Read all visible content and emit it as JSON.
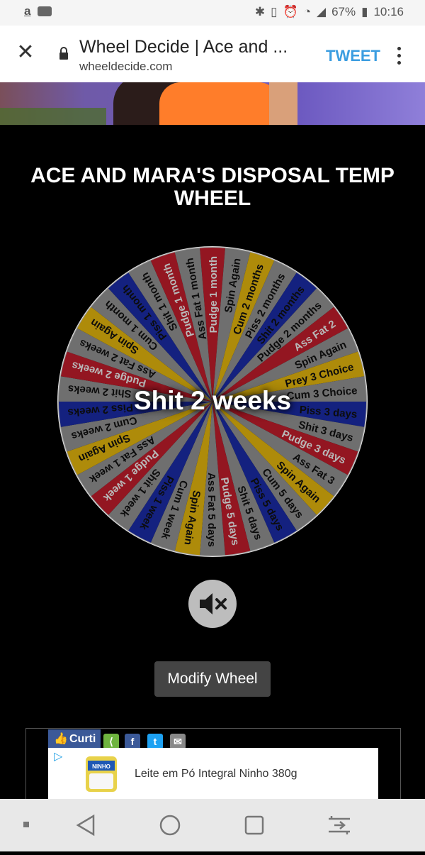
{
  "status": {
    "battery": "67%",
    "time": "10:16"
  },
  "browser": {
    "title": "Wheel Decide | Ace and ...",
    "url": "wheeldecide.com",
    "tweet_label": "TWEET"
  },
  "wheel": {
    "title": "ACE AND MARA'S DISPOSAL TEMP WHEEL",
    "result": "Shit 2 weeks",
    "segments": [
      "Pudge 1 month",
      "Spin Again",
      "Cum 2 months",
      "Piss 2 months",
      "Shit 2 months",
      "Pudge 2 months",
      "Ass Fat 2",
      "Spin Again",
      "Prey 3 Choice",
      "Cum 3 Choice",
      "Piss 3 days",
      "Shit 3 days",
      "Pudge 3 days",
      "Ass Fat 3",
      "Spin Again",
      "Cum 5 days",
      "Piss 5 days",
      "Shit 5 days",
      "Pudge 5 days",
      "Ass Fat 5 days",
      "Spin Again",
      "Cum 1 week",
      "Piss 1 week",
      "Shit 1 week",
      "Pudge 1 week",
      "Ass Fat 1 week",
      "Spin Again",
      "Cum 2 weeks",
      "Piss 2 weeks",
      "Shit 2 weeks",
      "Pudge 2 weeks",
      "Ass Fat 2 weeks",
      "Spin Again",
      "Cum 1 month",
      "Piss 1 month",
      "Shit 1 month",
      "Pudge 1 month",
      "Ass Fat 1 month"
    ],
    "colors": [
      "#cc1f2e",
      "#9a9a9a",
      "#f1c10e",
      "#9a9a9a",
      "#1c2fb0",
      "#9a9a9a"
    ]
  },
  "buttons": {
    "modify": "Modify Wheel"
  },
  "ad": {
    "like_label": "Curti",
    "text": "Leite em Pó Integral Ninho 380g",
    "brand": "NINHO"
  }
}
